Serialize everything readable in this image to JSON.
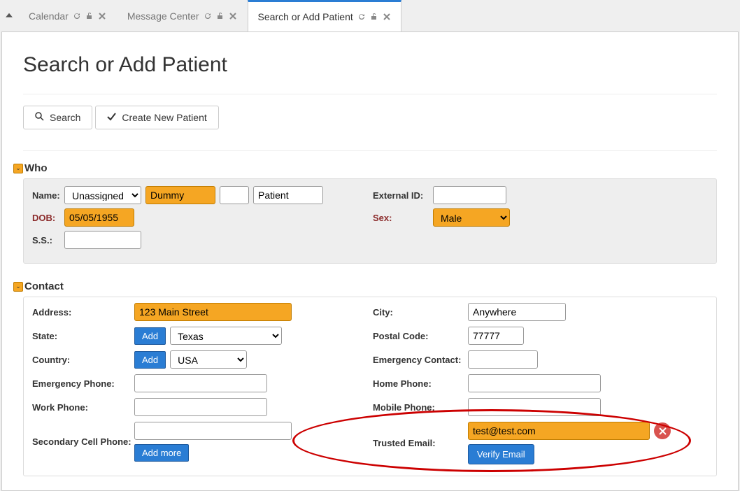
{
  "tabs": {
    "calendar": "Calendar",
    "message_center": "Message Center",
    "search_add": "Search or Add Patient"
  },
  "page_title": "Search or Add Patient",
  "buttons": {
    "search": "Search",
    "create": "Create New Patient",
    "add": "Add",
    "add_more": "Add more",
    "verify_email": "Verify Email"
  },
  "sections": {
    "who": "Who",
    "contact": "Contact"
  },
  "who": {
    "name_label": "Name:",
    "title_select": "Unassigned",
    "first_name": "Dummy",
    "middle_name": "",
    "last_name": "Patient",
    "external_id_label": "External ID:",
    "external_id": "",
    "dob_label": "DOB:",
    "dob": "05/05/1955",
    "sex_label": "Sex:",
    "sex": "Male",
    "ss_label": "S.S.:",
    "ss": ""
  },
  "contact": {
    "address_label": "Address:",
    "address": "123 Main Street",
    "state_label": "State:",
    "state": "Texas",
    "country_label": "Country:",
    "country": "USA",
    "emergency_phone_label": "Emergency Phone:",
    "emergency_phone": "",
    "work_phone_label": "Work Phone:",
    "work_phone": "",
    "secondary_cell_label": "Secondary Cell Phone:",
    "city_label": "City:",
    "city": "Anywhere",
    "postal_label": "Postal Code:",
    "postal": "77777",
    "emergency_contact_label": "Emergency Contact:",
    "emergency_contact": "",
    "home_phone_label": "Home Phone:",
    "home_phone": "",
    "mobile_phone_label": "Mobile Phone:",
    "mobile_phone": "",
    "trusted_email_label": "Trusted Email:",
    "trusted_email": "test@test.com"
  }
}
